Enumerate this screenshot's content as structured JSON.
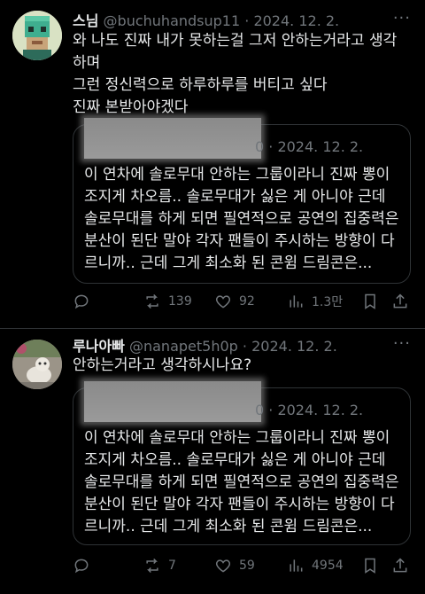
{
  "posts": [
    {
      "name": "스님",
      "handle": "@buchuhandsup11",
      "dot": "·",
      "date": "2024. 12. 2.",
      "more": "···",
      "text": "와 나도 진짜 내가 못하는걸 그저 안하는거라고 생각하며\n그런 정신력으로 하루하루를 버티고 싶다\n진짜 본받아야겠다",
      "quote": {
        "meta_suffix": "0 · 2024. 12. 2.",
        "text": "이 연차에 솔로무대 안하는 그룹이라니 진짜 뽕이 조지게 차오름.. 솔로무대가 싫은 게 아니야 근데 솔로무대를 하게 되면 필연적으로 공연의 집중력은 분산이 된단 말야 각자 팬들이 주시하는 방향이 다르니까.. 근데 그게 최소화 된 콘윔 드림콘은..."
      },
      "stats": {
        "replies": "",
        "reposts": "139",
        "likes": "92",
        "views": "1.3만"
      }
    },
    {
      "name": "루나아빠",
      "handle": "@nanapet5h0p",
      "dot": "·",
      "date": "2024. 12. 2.",
      "more": "···",
      "text": "안하는거라고 생각하시나요?",
      "quote": {
        "meta_suffix": "0 · 2024. 12. 2.",
        "text": "이 연차에 솔로무대 안하는 그룹이라니 진짜 뽕이 조지게 차오름.. 솔로무대가 싫은 게 아니야 근데 솔로무대를 하게 되면 필연적으로 공연의 집중력은 분산이 된단 말야 각자 팬들이 주시하는 방향이 다르니까.. 근데 그게 최소화 된 콘윔 드림콘은..."
      },
      "stats": {
        "replies": "",
        "reposts": "7",
        "likes": "59",
        "views": "4954"
      }
    }
  ]
}
